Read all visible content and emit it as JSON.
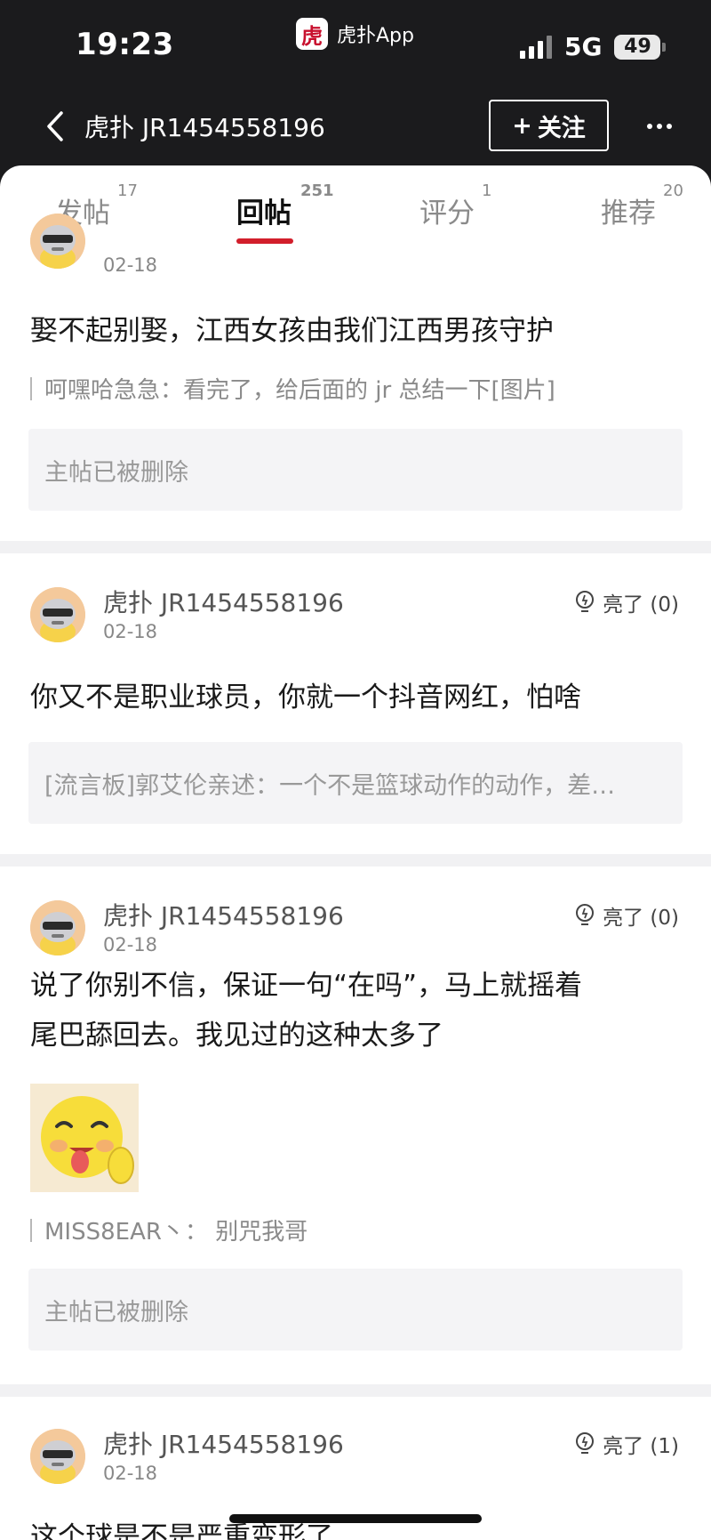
{
  "status_bar": {
    "time": "19:23",
    "app_logo_char": "虎",
    "app_name": "虎扑App",
    "network": "5G",
    "battery": "49"
  },
  "nav": {
    "title": "虎扑 JR1454558196",
    "follow_label": "关注",
    "follow_plus": "+"
  },
  "tabs": [
    {
      "label": "发帖",
      "count": "17"
    },
    {
      "label": "回帖",
      "count": "251",
      "active": true
    },
    {
      "label": "评分",
      "count": "1"
    },
    {
      "label": "推荐",
      "count": "20"
    }
  ],
  "posts": [
    {
      "date": "02-18",
      "content": "娶不起别娶，江西女孩由我们江西男孩守护",
      "quote_reply": "呵嘿哈急急：看完了，给后面的 jr 总结一下[图片]",
      "quote_box": "主帖已被删除"
    },
    {
      "author": "虎扑 JR1454558196",
      "date": "02-18",
      "light": "亮了 (0)",
      "content": "你又不是职业球员，你就一个抖音网红，怕啥",
      "quote_box": "[流言板]郭艾伦亲述：一个不是篮球动作的动作，差…"
    },
    {
      "author": "虎扑 JR1454558196",
      "date": "02-18",
      "light": "亮了 (0)",
      "content_line1": "说了你别不信，保证一句“在吗”，马上就摇着",
      "content_line2": "尾巴舔回去。我见过的这种太多了",
      "quote_reply": "MISS8EAR丶：  别咒我哥",
      "quote_box": "主帖已被删除"
    },
    {
      "author": "虎扑 JR1454558196",
      "date": "02-18",
      "light": "亮了 (1)",
      "content": "这个球是不是严重变形了"
    }
  ],
  "colors": {
    "header_bg": "#1b1b1d",
    "accent_red": "#d21e2b",
    "separator": "#f1f1f3",
    "quote_bg": "#f4f4f6"
  }
}
